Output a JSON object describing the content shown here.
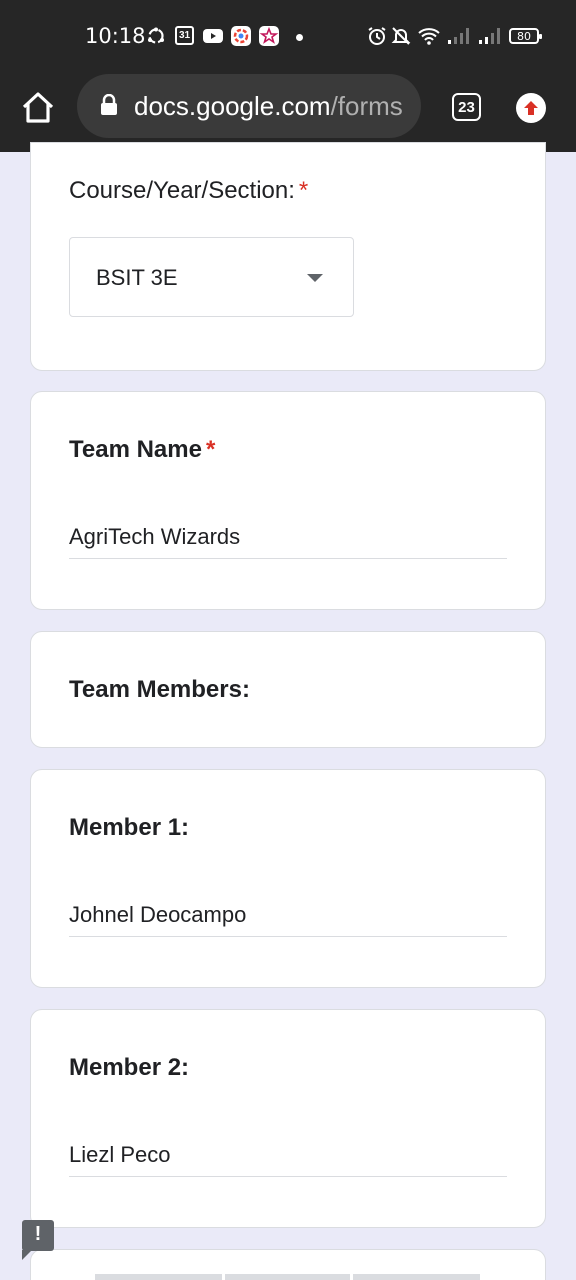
{
  "status_bar": {
    "time": "10:18",
    "calendar_badge": "31",
    "battery": "80",
    "icons": [
      "sync-icon",
      "calendar-icon",
      "youtube-icon",
      "photos-icon",
      "star-app-icon",
      "alarm-icon",
      "bell-off-icon",
      "wifi-icon",
      "signal-icon",
      "signal-icon",
      "battery-icon"
    ]
  },
  "browser": {
    "url_host": "docs.google.com",
    "url_path": "/forms",
    "tab_count": "23",
    "colors": {
      "bar": "#262626",
      "pill": "#3a3a3a",
      "update": "#d93025"
    }
  },
  "form": {
    "course": {
      "label": "Course/Year/Section:",
      "required": "*",
      "value": "BSIT 3E"
    },
    "team_name": {
      "label": "Team Name",
      "required": "*",
      "value": "AgriTech Wizards"
    },
    "team_members": {
      "label": "Team Members:"
    },
    "member1": {
      "label": "Member 1:",
      "value": "Johnel Deocampo"
    },
    "member2": {
      "label": "Member 2:",
      "value": "Liezl Peco"
    }
  },
  "feedback": {
    "icon_text": "!"
  },
  "colors": {
    "background": "#eaeaf8",
    "required": "#d93025"
  }
}
